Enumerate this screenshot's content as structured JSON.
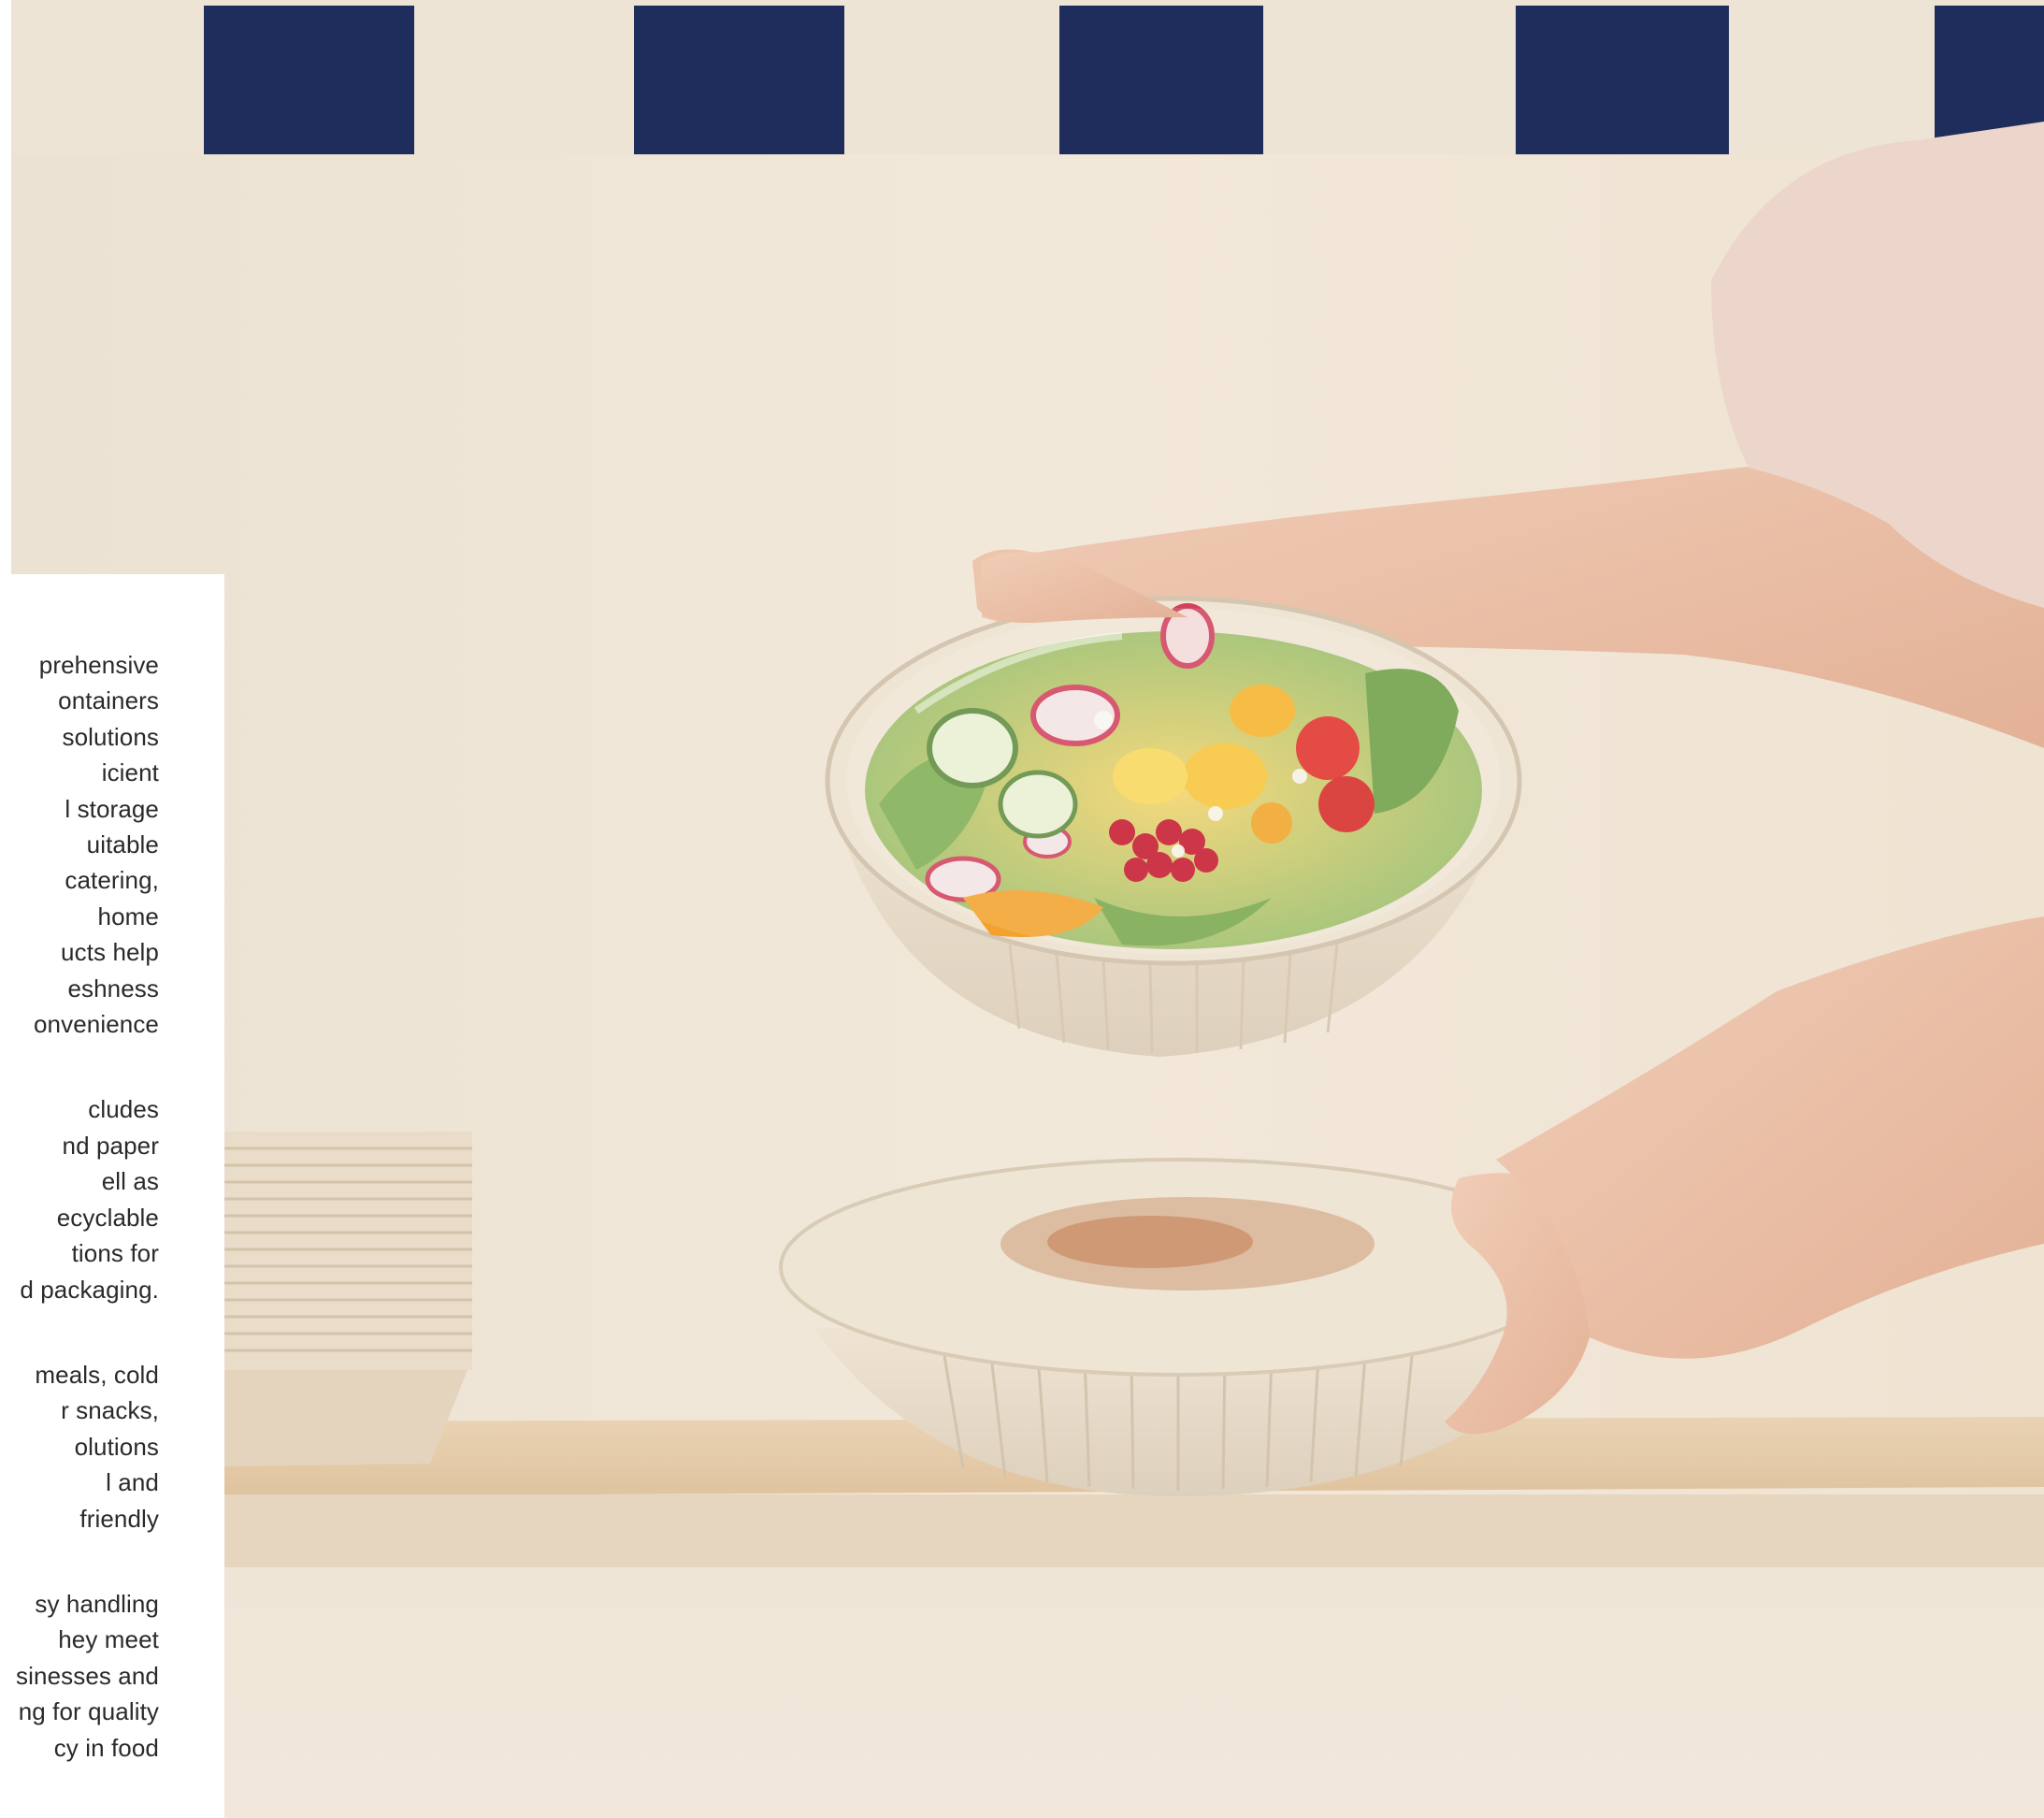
{
  "photo": {
    "subject": "hand-lifting-salad-bowl-icon",
    "colors": {
      "wall": "#f1e6d7",
      "awning_stripe": "#1f2d5c",
      "awning_light": "#ede4d5",
      "bowl": "#ebdfcd",
      "shelf": "#e2c7a4"
    }
  },
  "text_panel": {
    "paragraphs": [
      {
        "lines": [
          "prehensive",
          "ontainers",
          "solutions",
          "icient",
          "l storage",
          "uitable",
          "catering,",
          "home",
          "ucts help",
          "eshness",
          "onvenience"
        ]
      },
      {
        "lines": [
          "cludes",
          "nd paper",
          "ell as",
          "ecyclable",
          "tions for",
          "d packaging."
        ]
      },
      {
        "lines": [
          "meals, cold",
          "r snacks,",
          "olutions",
          "l and",
          "friendly"
        ]
      },
      {
        "lines": [
          "sy handling",
          "hey meet",
          "sinesses and",
          "ng for quality",
          "cy in food"
        ]
      }
    ]
  }
}
